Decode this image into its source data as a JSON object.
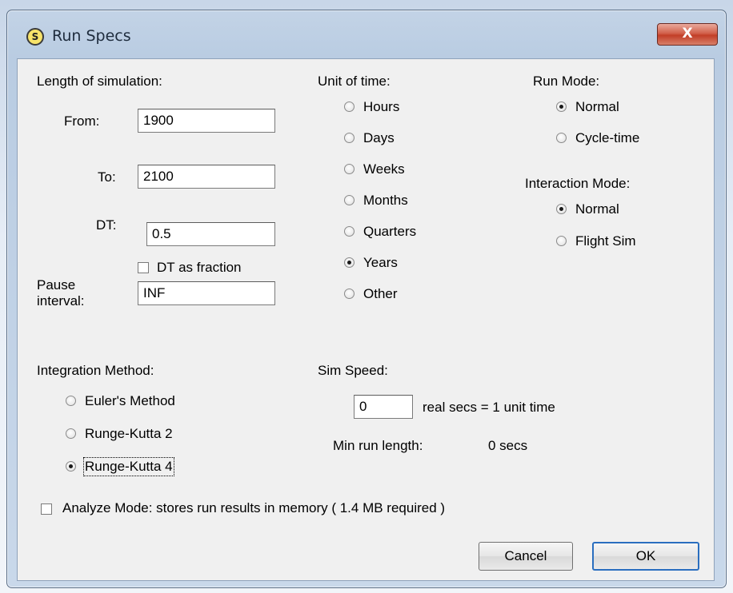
{
  "window": {
    "title": "Run Specs",
    "close_glyph": "X",
    "app_icon_letter": "S"
  },
  "length": {
    "heading": "Length of simulation:",
    "from_label": "From:",
    "from_value": "1900",
    "to_label": "To:",
    "to_value": "2100",
    "dt_label": "DT:",
    "dt_value": "0.5",
    "dt_fraction_label": "DT as fraction",
    "dt_fraction_checked": false,
    "pause_label_line1": "Pause",
    "pause_label_line2": "interval:",
    "pause_value": "INF"
  },
  "unit_of_time": {
    "heading": "Unit of time:",
    "options": [
      "Hours",
      "Days",
      "Weeks",
      "Months",
      "Quarters",
      "Years",
      "Other"
    ],
    "selected": "Years"
  },
  "run_mode": {
    "heading": "Run Mode:",
    "options": [
      "Normal",
      "Cycle-time"
    ],
    "selected": "Normal"
  },
  "interaction_mode": {
    "heading": "Interaction Mode:",
    "options": [
      "Normal",
      "Flight Sim"
    ],
    "selected": "Normal"
  },
  "integration": {
    "heading": "Integration Method:",
    "options": [
      "Euler's Method",
      "Runge-Kutta 2",
      "Runge-Kutta 4"
    ],
    "selected": "Runge-Kutta 4"
  },
  "sim_speed": {
    "heading": "Sim Speed:",
    "value": "0",
    "suffix": "real secs = 1 unit time",
    "min_run_label": "Min run length:",
    "min_run_value": "0 secs"
  },
  "analyze": {
    "label": "Analyze Mode: stores run results in memory ( 1.4 MB required )",
    "checked": false
  },
  "buttons": {
    "cancel": "Cancel",
    "ok": "OK"
  },
  "icons": {
    "app": "app-s-icon",
    "close": "close-icon"
  }
}
